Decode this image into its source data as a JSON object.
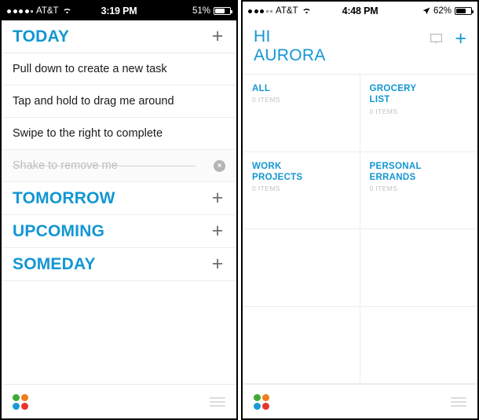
{
  "accent_blue": "#1296d3",
  "left_screen": {
    "status_bar": {
      "carrier": "AT&T",
      "time": "3:19 PM",
      "battery_percent": "51%"
    },
    "sections": [
      {
        "title": "TODAY",
        "add_label": "+"
      },
      {
        "title": "TOMORROW",
        "add_label": "+"
      },
      {
        "title": "UPCOMING",
        "add_label": "+"
      },
      {
        "title": "SOMEDAY",
        "add_label": "+"
      }
    ],
    "tasks": [
      {
        "text": "Pull down to create a new task",
        "done": false
      },
      {
        "text": "Tap and hold to drag me around",
        "done": false
      },
      {
        "text": "Swipe to the right to complete",
        "done": false
      },
      {
        "text": "Shake to remove me",
        "done": true,
        "clear_label": "×"
      }
    ],
    "bottom_bar": {
      "logo_colors": [
        "#3faa35",
        "#f07d1a",
        "#1b9ad6",
        "#e8362c"
      ],
      "menu_icon": "hamburger-icon"
    }
  },
  "right_screen": {
    "status_bar": {
      "carrier": "AT&T",
      "time": "4:48 PM",
      "battery_percent": "62%",
      "location_icon": "location-arrow-icon"
    },
    "greeting": {
      "line1": "HI",
      "line2": "AURORA",
      "comment_icon": "comment-icon",
      "add_label": "+"
    },
    "lists": [
      {
        "title": "ALL",
        "items": "0 ITEMS"
      },
      {
        "title": "GROCERY\nLIST",
        "items": "0 ITEMS"
      },
      {
        "title": "WORK\nPROJECTS",
        "items": "0 ITEMS"
      },
      {
        "title": "PERSONAL\nERRANDS",
        "items": "0 ITEMS"
      }
    ],
    "bottom_bar": {
      "logo_colors": [
        "#3faa35",
        "#f07d1a",
        "#1b9ad6",
        "#e8362c"
      ],
      "menu_icon": "hamburger-icon"
    }
  }
}
